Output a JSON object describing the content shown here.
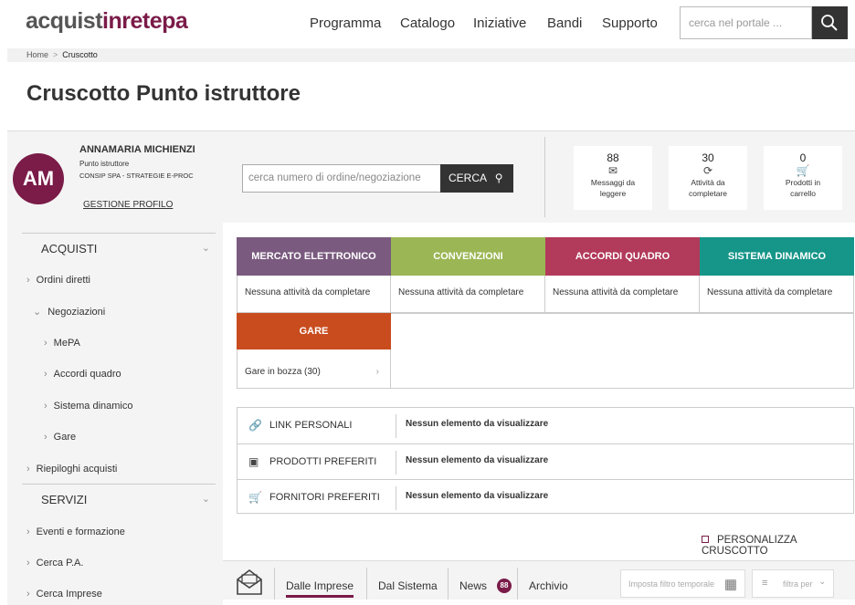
{
  "brand": {
    "part1": "acquist",
    "part2": "inrete",
    "part3": "pa"
  },
  "nav": [
    "Programma",
    "Catalogo",
    "Iniziative",
    "Bandi",
    "Supporto"
  ],
  "search": {
    "placeholder": "cerca nel portale ..."
  },
  "breadcrumb": {
    "home": "Home",
    "sep": ">",
    "current": "Cruscotto"
  },
  "page_title": "Cruscotto Punto istruttore",
  "user": {
    "initials": "AM",
    "name": "ANNAMARIA MICHIENZI",
    "role": "Punto istruttore",
    "org": "CONSIP SPA - STRATEGIE E-PROC",
    "profile_link": "GESTIONE PROFILO"
  },
  "sidebar": {
    "acquisti": "ACQUISTI",
    "items": [
      "Ordini diretti",
      "Negoziazioni",
      "MePA",
      "Accordi quadro",
      "Sistema dinamico",
      "Gare",
      "Riepiloghi acquisti"
    ],
    "servizi": "SERVIZI",
    "servizi_items": [
      "Eventi e formazione",
      "Cerca P.A.",
      "Cerca Imprese"
    ]
  },
  "order_search": {
    "placeholder": "cerca numero di ordine/negoziazione",
    "button": "CERCA"
  },
  "stats": [
    {
      "value": "88",
      "label1": "Messaggi da",
      "label2": "leggere",
      "icon": "envelope-icon"
    },
    {
      "value": "30",
      "label1": "Attività da",
      "label2": "completare",
      "icon": "spinner-icon"
    },
    {
      "value": "0",
      "label1": "Prodotti in",
      "label2": "carrello",
      "icon": "cart-icon"
    }
  ],
  "categories": [
    {
      "title": "MERCATO ELETTRONICO",
      "status": "Nessuna attività da completare",
      "color": "#7a5a7f"
    },
    {
      "title": "CONVENZIONI",
      "status": "Nessuna attività da completare",
      "color": "#9bb654"
    },
    {
      "title": "ACCORDI QUADRO",
      "status": "Nessuna attività da completare",
      "color": "#b23a5b"
    },
    {
      "title": "SISTEMA DINAMICO",
      "status": "Nessuna attività da completare",
      "color": "#169589"
    }
  ],
  "gare": {
    "title": "GARE",
    "item": "Gare in bozza (30)"
  },
  "prefs": [
    {
      "label": "LINK PERSONALI",
      "value": "Nessun elemento da visualizzare"
    },
    {
      "label": "PRODOTTI PREFERITI",
      "value": "Nessun elemento da visualizzare"
    },
    {
      "label": "FORNITORI PREFERITI",
      "value": "Nessun elemento da visualizzare"
    }
  ],
  "personalize": "PERSONALIZZA CRUSCOTTO",
  "tabs": {
    "imprese": "Dalle Imprese",
    "sistema": "Dal Sistema",
    "news": "News",
    "news_count": "88",
    "archivio": "Archivio"
  },
  "filters": {
    "date": "Imposta filtro temporale",
    "per": "filtra per"
  }
}
